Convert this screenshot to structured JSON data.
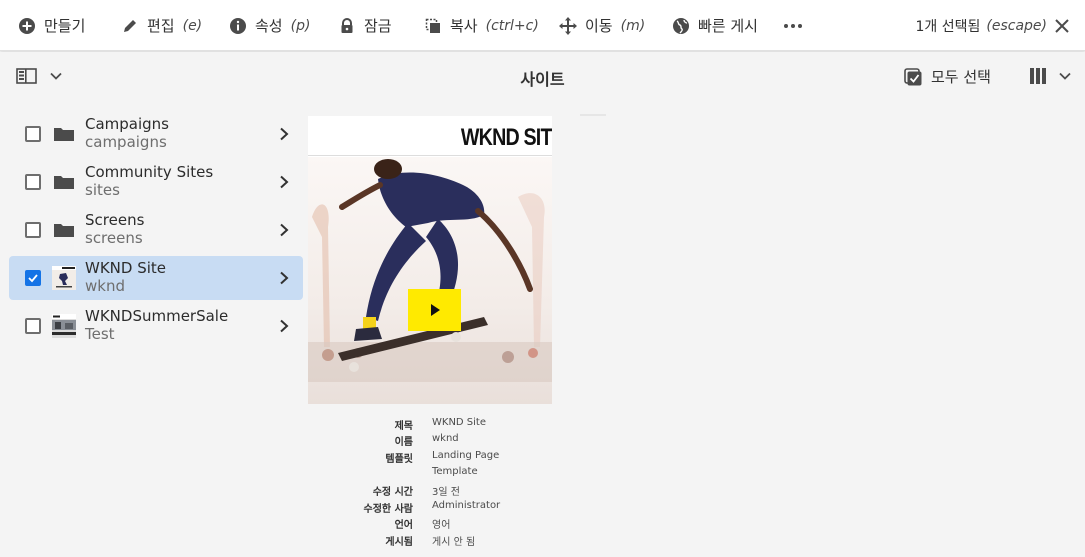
{
  "actionbar": {
    "create": "만들기",
    "edit": {
      "label": "편집",
      "shortcut": "(e)"
    },
    "properties": {
      "label": "속성",
      "shortcut": "(p)"
    },
    "lock": "잠금",
    "copy": {
      "label": "복사",
      "shortcut": "(ctrl+c)"
    },
    "move": {
      "label": "이동",
      "shortcut": "(m)"
    },
    "quick_publish": "빠른 게시",
    "selection": {
      "label": "1개 선택됨",
      "shortcut": "(escape)"
    }
  },
  "header": {
    "title": "사이트",
    "select_all": "모두 선택"
  },
  "list": {
    "items": [
      {
        "title": "Campaigns",
        "name": "campaigns",
        "icon": "folder-icon",
        "selected": false
      },
      {
        "title": "Community Sites",
        "name": "sites",
        "icon": "folder-icon",
        "selected": false
      },
      {
        "title": "Screens",
        "name": "screens",
        "icon": "folder-icon",
        "selected": false
      },
      {
        "title": "WKND Site",
        "name": "wknd",
        "icon": "thumbnail",
        "selected": true
      },
      {
        "title": "WKNDSummerSale",
        "name": "Test",
        "icon": "thumbnail",
        "selected": false
      }
    ]
  },
  "preview": {
    "brand": "WKND SIT",
    "properties": [
      {
        "label": "제목",
        "value": "WKND Site"
      },
      {
        "label": "이름",
        "value": "wknd"
      },
      {
        "label": "템플릿",
        "value": "Landing Page"
      },
      {
        "label": "",
        "value": "Template"
      },
      {
        "label": "수정 시간",
        "value": "3일 전"
      },
      {
        "label": "수정한 사람",
        "value": "Administrator"
      },
      {
        "label": "언어",
        "value": "영어"
      },
      {
        "label": "게시됨",
        "value": "게시 안 됨"
      }
    ]
  },
  "colors": {
    "accent": "#1473e6",
    "selected_row": "#c8dcf3",
    "play_button": "#ffea00"
  }
}
